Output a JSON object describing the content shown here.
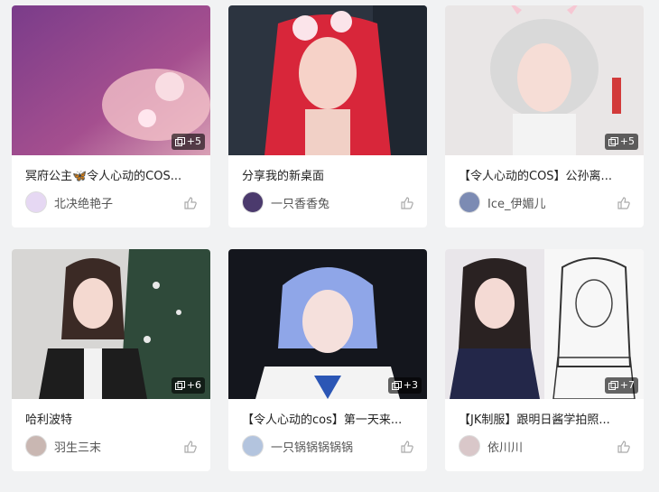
{
  "cards": [
    {
      "title": "冥府公主🦋令人心动的COS...",
      "author": "北决绝艳子",
      "badge": "+5"
    },
    {
      "title": "分享我的新桌面",
      "author": "一只香香兔",
      "badge": ""
    },
    {
      "title": "【令人心动的COS】公孙离...",
      "author": "Ice_伊媚儿",
      "badge": "+5"
    },
    {
      "title": "哈利波特",
      "author": "羽生三末",
      "badge": "+6"
    },
    {
      "title": "【令人心动的cos】第一天来...",
      "author": "一只锅锅锅锅锅",
      "badge": "+3"
    },
    {
      "title": "【JK制服】跟明日酱学拍照...",
      "author": "依川川",
      "badge": "+7"
    }
  ],
  "icons": {
    "badge": "images-icon",
    "like": "thumbs-up-icon"
  }
}
